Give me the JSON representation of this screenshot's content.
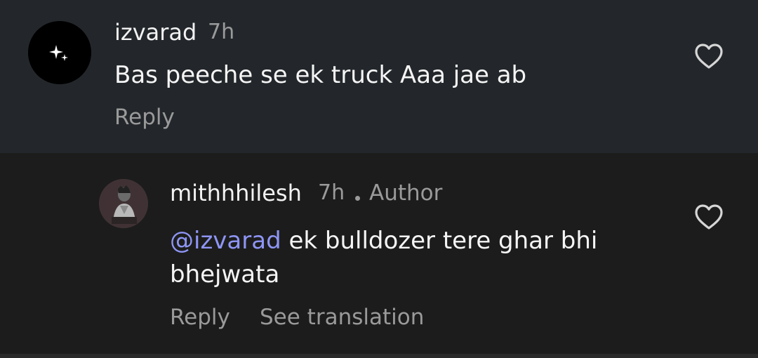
{
  "comments": [
    {
      "username": "izvarad",
      "time": "7h",
      "text": "Bas peeche se ek truck Aaa jae ab",
      "reply_label": "Reply",
      "avatar_icon": "sparkle-icon",
      "like_icon": "heart-outline-icon"
    },
    {
      "username": "mithhhilesh",
      "time": "7h",
      "badge": "Author",
      "mention": "@izvarad",
      "text_line1_rest": " ek bulldozer tere ghar bhi",
      "text_line2": "bhejwata",
      "reply_label": "Reply",
      "translate_label": "See translation",
      "avatar_icon": "profile-photo",
      "like_icon": "heart-outline-icon"
    }
  ],
  "colors": {
    "top_bg": "#23272b",
    "reply_bg": "#1c1c1c",
    "mention": "#8e95f5",
    "muted": "#9a9a9a",
    "text": "#f5f5f5"
  }
}
